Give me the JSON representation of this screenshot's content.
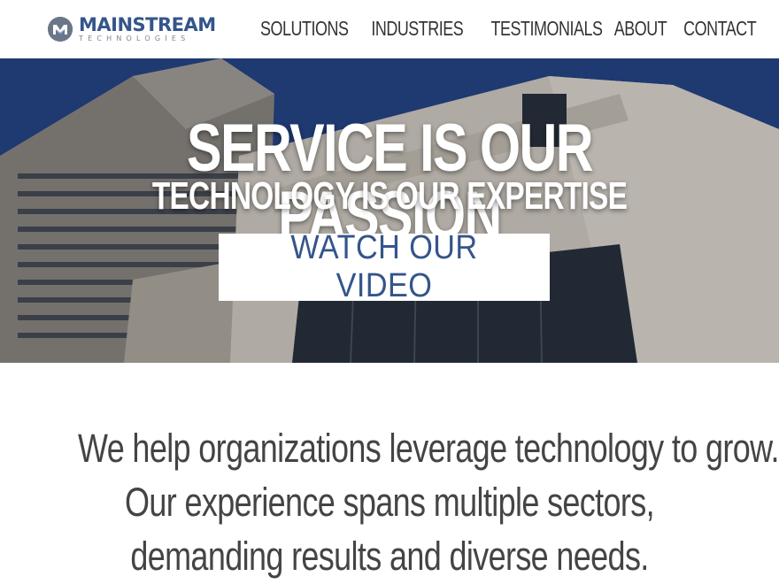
{
  "brand": {
    "name": "MAINSTREAM",
    "tagline": "TECHNOLOGIES",
    "colors": {
      "primary": "#34558b",
      "gray": "#6b7788"
    }
  },
  "nav": {
    "items": [
      {
        "label": "SOLUTIONS"
      },
      {
        "label": "INDUSTRIES"
      },
      {
        "label": "TESTIMONIALS"
      },
      {
        "label": "ABOUT"
      },
      {
        "label": "CONTACT"
      }
    ]
  },
  "hero": {
    "headline": "SERVICE IS OUR PASSION",
    "subheadline": "TECHNOLOGY IS OUR EXPERTISE",
    "cta_label": "WATCH OUR VIDEO",
    "background_image": "buildings-skyline"
  },
  "intro": {
    "lines": [
      "We help organizations leverage technology to grow.",
      "Our experience spans multiple sectors,",
      "demanding results and diverse needs."
    ]
  }
}
